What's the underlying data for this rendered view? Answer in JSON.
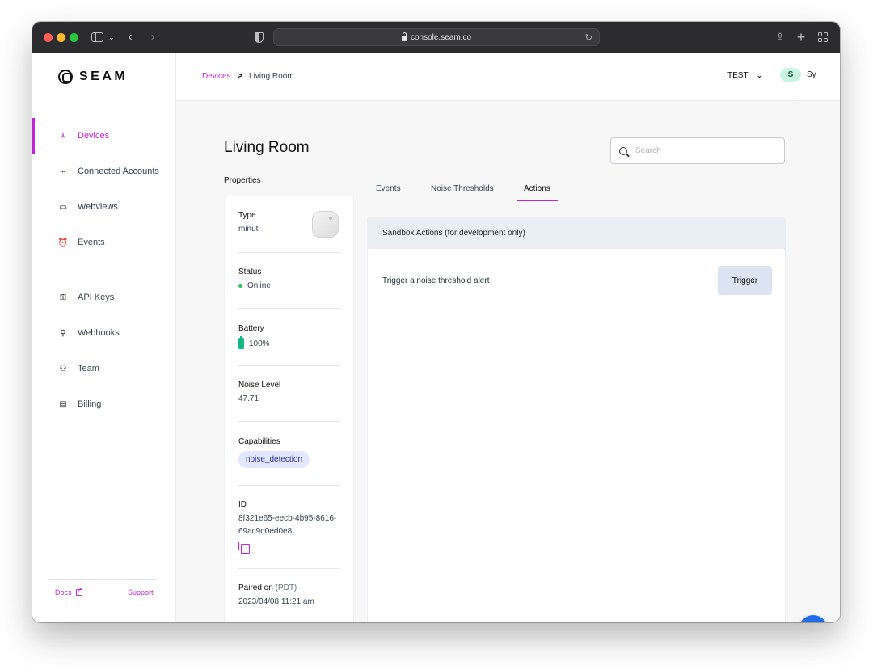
{
  "browser": {
    "url": "console.seam.co"
  },
  "brand": {
    "name": "SEAM"
  },
  "sidebar": {
    "items": [
      {
        "label": "Devices",
        "icon": "devices-icon",
        "active": true
      },
      {
        "label": "Connected Accounts",
        "icon": "plug-icon"
      },
      {
        "label": "Webviews",
        "icon": "window-icon"
      },
      {
        "label": "Events",
        "icon": "alarm-icon"
      },
      {
        "label": "API Keys",
        "icon": "key-icon"
      },
      {
        "label": "Webhooks",
        "icon": "webhook-icon"
      },
      {
        "label": "Team",
        "icon": "team-icon"
      },
      {
        "label": "Billing",
        "icon": "credit-card-icon"
      }
    ],
    "footer": {
      "docs": "Docs",
      "support": "Support"
    }
  },
  "topbar": {
    "breadcrumb": {
      "root": "Devices",
      "separator": ">",
      "current": "Living Room"
    },
    "workspace": "TEST",
    "user": {
      "initial": "S",
      "name": "Sy"
    }
  },
  "page": {
    "title": "Living Room",
    "search_placeholder": "Search",
    "properties_label": "Properties"
  },
  "properties": {
    "type": {
      "label": "Type",
      "value": "minut"
    },
    "status": {
      "label": "Status",
      "value": "Online"
    },
    "battery": {
      "label": "Battery",
      "value": "100%"
    },
    "noise": {
      "label": "Noise Level",
      "value": "47.71"
    },
    "capabilities": {
      "label": "Capabilities",
      "value": "noise_detection"
    },
    "id": {
      "label": "ID",
      "value": "8f321e65-eecb-4b95-8616-69ac9d0ed0e8"
    },
    "paired": {
      "label": "Paired on",
      "tz": "(PDT)",
      "value": "2023/04/08 11:21 am"
    }
  },
  "tabs": [
    {
      "label": "Events"
    },
    {
      "label": "Noise Thresholds"
    },
    {
      "label": "Actions",
      "active": true
    }
  ],
  "actions_panel": {
    "title": "Sandbox Actions (for development only)",
    "rows": [
      {
        "label": "Trigger a noise threshold alert",
        "button": "Trigger"
      }
    ]
  },
  "colors": {
    "accent": "#c026d3",
    "online": "#22c55e",
    "battery": "#10b981",
    "chat": "#1f6feb"
  }
}
